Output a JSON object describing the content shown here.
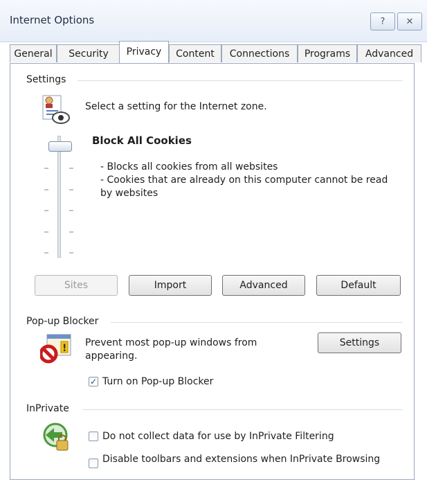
{
  "window": {
    "title": "Internet Options",
    "help_glyph": "?",
    "close_glyph": "✕"
  },
  "tabs": [
    {
      "label": "General"
    },
    {
      "label": "Security"
    },
    {
      "label": "Privacy",
      "active": true
    },
    {
      "label": "Content"
    },
    {
      "label": "Connections"
    },
    {
      "label": "Programs"
    },
    {
      "label": "Advanced"
    }
  ],
  "settings": {
    "group_label": "Settings",
    "zone_prompt": "Select a setting for the Internet zone.",
    "level_title": "Block All Cookies",
    "desc_line1": "- Blocks all cookies from all websites",
    "desc_line2": "- Cookies that are already on this computer cannot be read",
    "desc_line3": "by websites",
    "buttons": {
      "sites": "Sites",
      "import": "Import",
      "advanced": "Advanced",
      "default": "Default"
    }
  },
  "popup_blocker": {
    "group_label": "Pop-up Blocker",
    "desc_line1": "Prevent most pop-up windows from",
    "desc_line2": "appearing.",
    "settings_button": "Settings",
    "checkbox_label": "Turn on Pop-up Blocker",
    "checked": true
  },
  "inprivate": {
    "group_label": "InPrivate",
    "checkbox1_label": "Do not collect data for use by InPrivate Filtering",
    "checkbox2_label": "Disable toolbars and extensions when InPrivate Browsing",
    "checkbox1_checked": false,
    "checkbox2_checked": false
  },
  "check_glyph": "✓",
  "colors": {
    "tab_border": "#9aa8bd",
    "accent_blue": "#2c4f8f",
    "popup_red": "#cc1b1b"
  }
}
